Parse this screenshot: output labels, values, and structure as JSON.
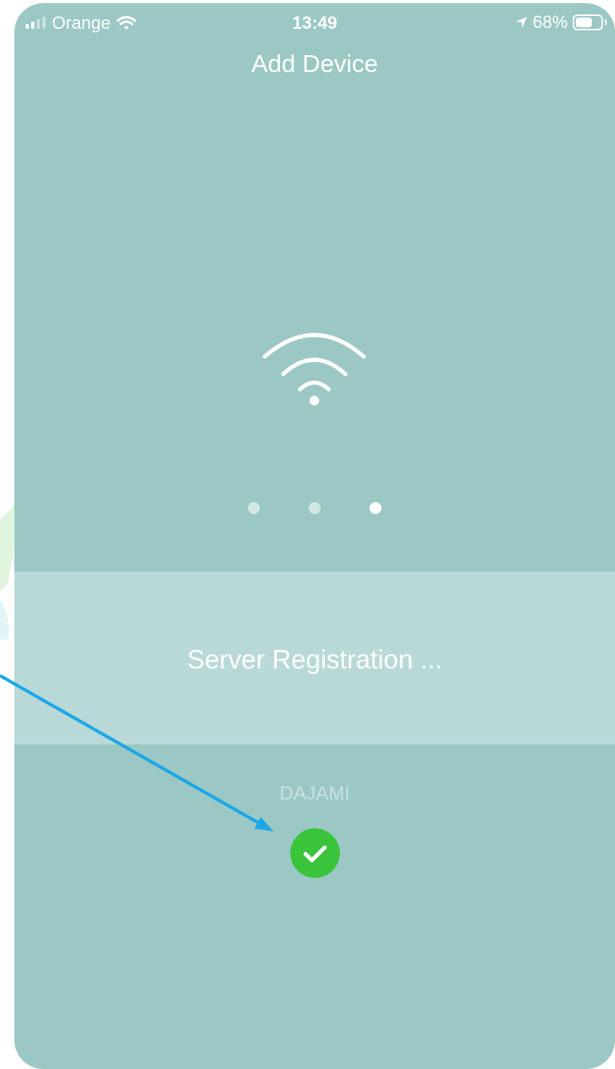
{
  "status_bar": {
    "carrier": "Orange",
    "time": "13:49",
    "battery_percent": "68%",
    "battery_level": 0.68
  },
  "header": {
    "title": "Add Device"
  },
  "progress": {
    "steps": 3,
    "current_step": 3
  },
  "status": {
    "message": "Server Registration ..."
  },
  "device": {
    "name": "DAJAMI",
    "registered_icon": "check-circle-icon"
  },
  "colors": {
    "background": "#9bc8c4",
    "band": "#b8d9d7",
    "success": "#3ac43c",
    "annotation_arrow": "#1aa7e8"
  }
}
